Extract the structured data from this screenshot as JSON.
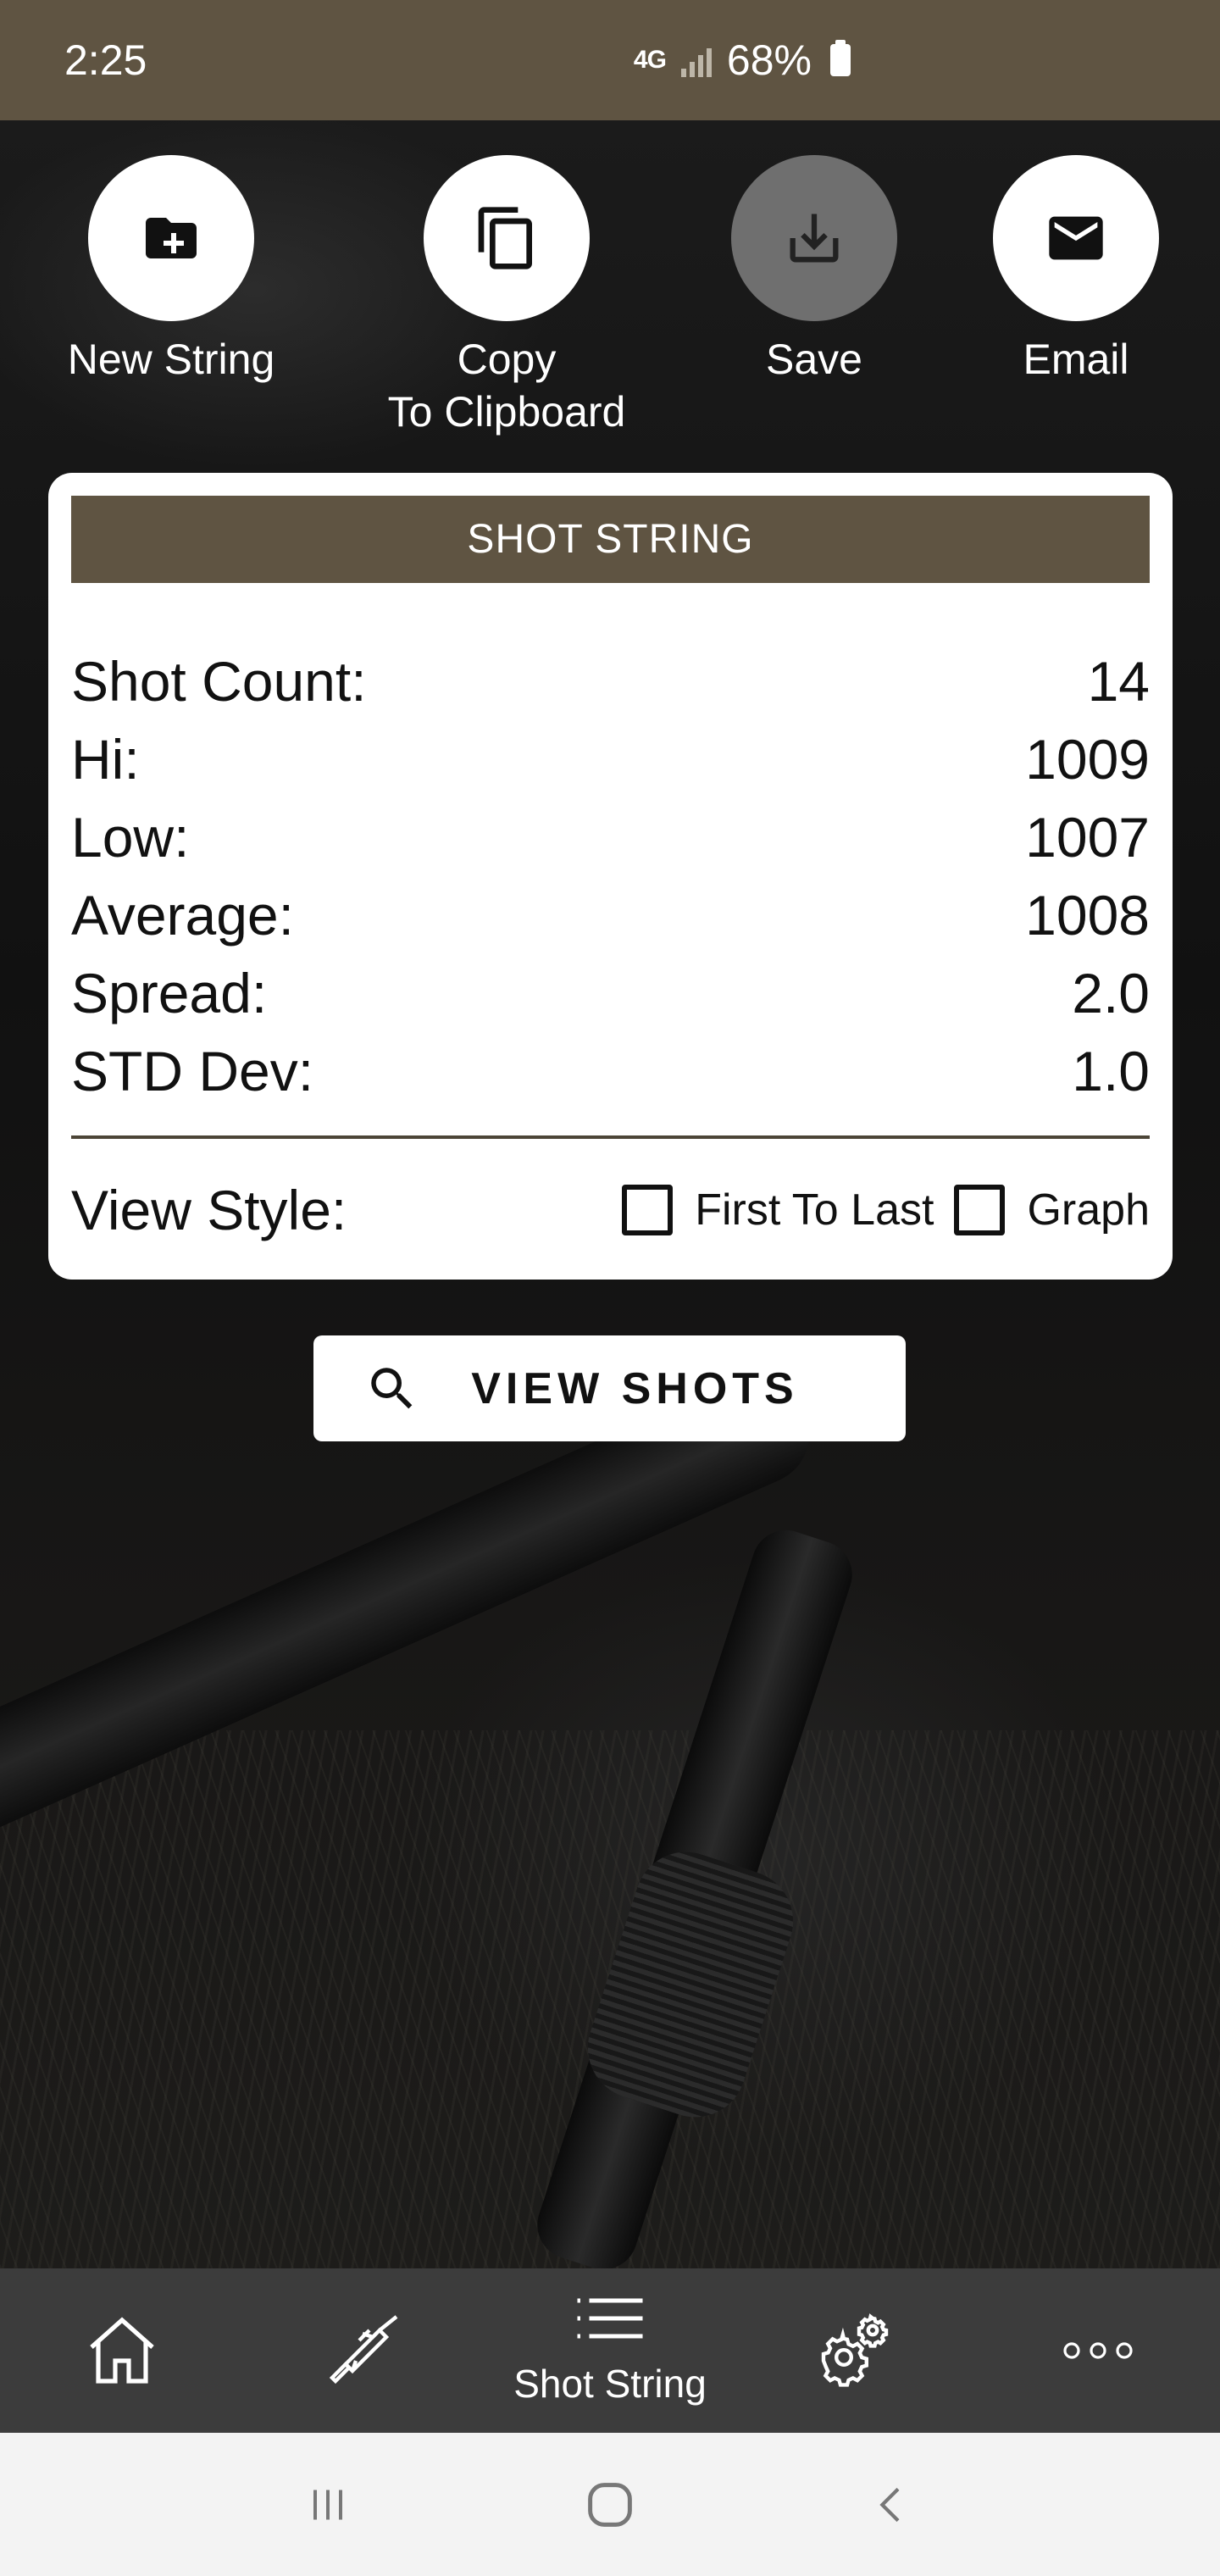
{
  "status_bar": {
    "time": "2:25",
    "network": "4G",
    "battery": "68%"
  },
  "actions": [
    {
      "label": "New String",
      "icon": "folder-plus-icon",
      "disabled": false
    },
    {
      "label": "Copy\nTo Clipboard",
      "icon": "copy-icon",
      "disabled": false
    },
    {
      "label": "Save",
      "icon": "download-icon",
      "disabled": true
    },
    {
      "label": "Email",
      "icon": "mail-icon",
      "disabled": false
    }
  ],
  "card": {
    "title": "SHOT STRING",
    "stats": [
      {
        "label": "Shot Count:",
        "value": "14"
      },
      {
        "label": "Hi:",
        "value": "1009"
      },
      {
        "label": "Low:",
        "value": "1007"
      },
      {
        "label": "Average:",
        "value": "1008"
      },
      {
        "label": "Spread:",
        "value": "2.0"
      },
      {
        "label": "STD Dev:",
        "value": "1.0"
      }
    ],
    "view_style": {
      "label": "View Style:",
      "options": [
        {
          "label": "First To Last",
          "checked": false
        },
        {
          "label": "Graph",
          "checked": false
        }
      ]
    }
  },
  "view_shots_button": {
    "label": "VIEW SHOTS",
    "icon": "search-icon"
  },
  "bottom_nav": [
    {
      "icon": "home-icon",
      "label": ""
    },
    {
      "icon": "rifle-icon",
      "label": ""
    },
    {
      "icon": "list-icon",
      "label": "Shot String",
      "active": true
    },
    {
      "icon": "gear-icon",
      "label": ""
    },
    {
      "icon": "more-icon",
      "label": ""
    }
  ],
  "colors": {
    "brand": "#5f5442",
    "nav_bg": "#3c3c3c",
    "card_bg": "#ffffff"
  }
}
